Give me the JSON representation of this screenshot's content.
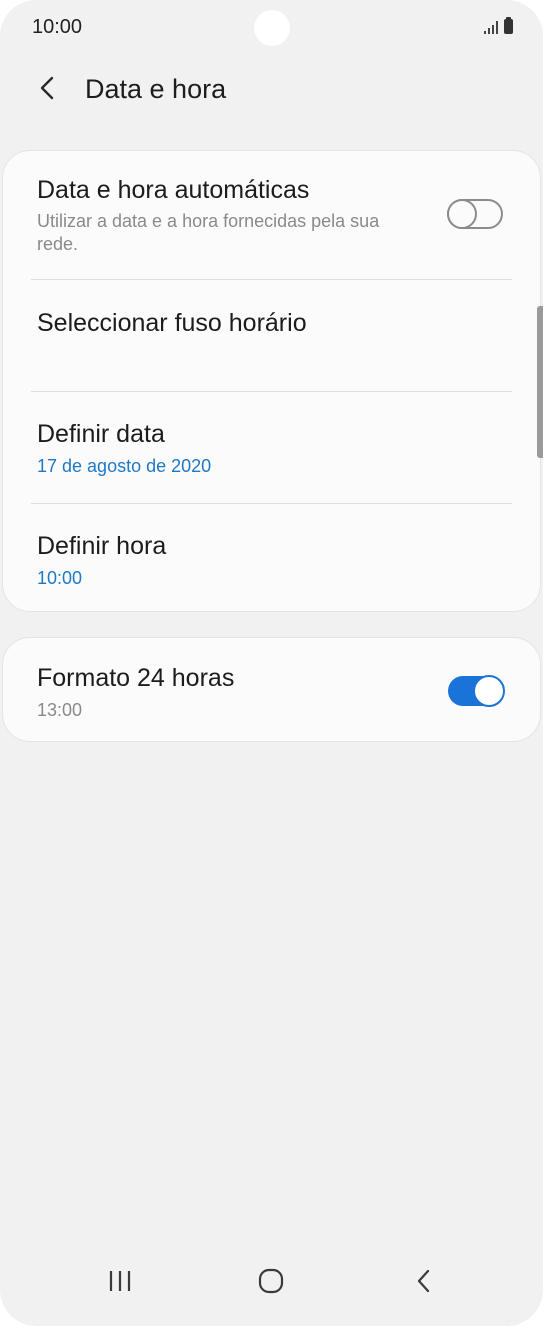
{
  "status_bar": {
    "time": "10:00",
    "icons": [
      "signal-icon",
      "battery-icon"
    ]
  },
  "header": {
    "back_icon": "chevron-left-icon",
    "title": "Data e hora"
  },
  "settings": {
    "auto_datetime": {
      "title": "Data e hora automáticas",
      "subtitle": "Utilizar a data e a hora fornecidas pela sua rede.",
      "enabled": false
    },
    "timezone": {
      "title": "Seleccionar fuso horário"
    },
    "set_date": {
      "title": "Definir data",
      "value": "17 de agosto de 2020"
    },
    "set_time": {
      "title": "Definir hora",
      "value": "10:00"
    },
    "format_24h": {
      "title": "Formato 24 horas",
      "value": "13:00",
      "enabled": true
    }
  },
  "nav_bar": {
    "recent_icon": "recent-apps-icon",
    "home_icon": "home-icon",
    "back_icon": "back-icon"
  },
  "colors": {
    "accent": "#1a73d9",
    "value_blue": "#1f78c6",
    "background": "#f1f1f1",
    "card": "#fbfbfb"
  }
}
